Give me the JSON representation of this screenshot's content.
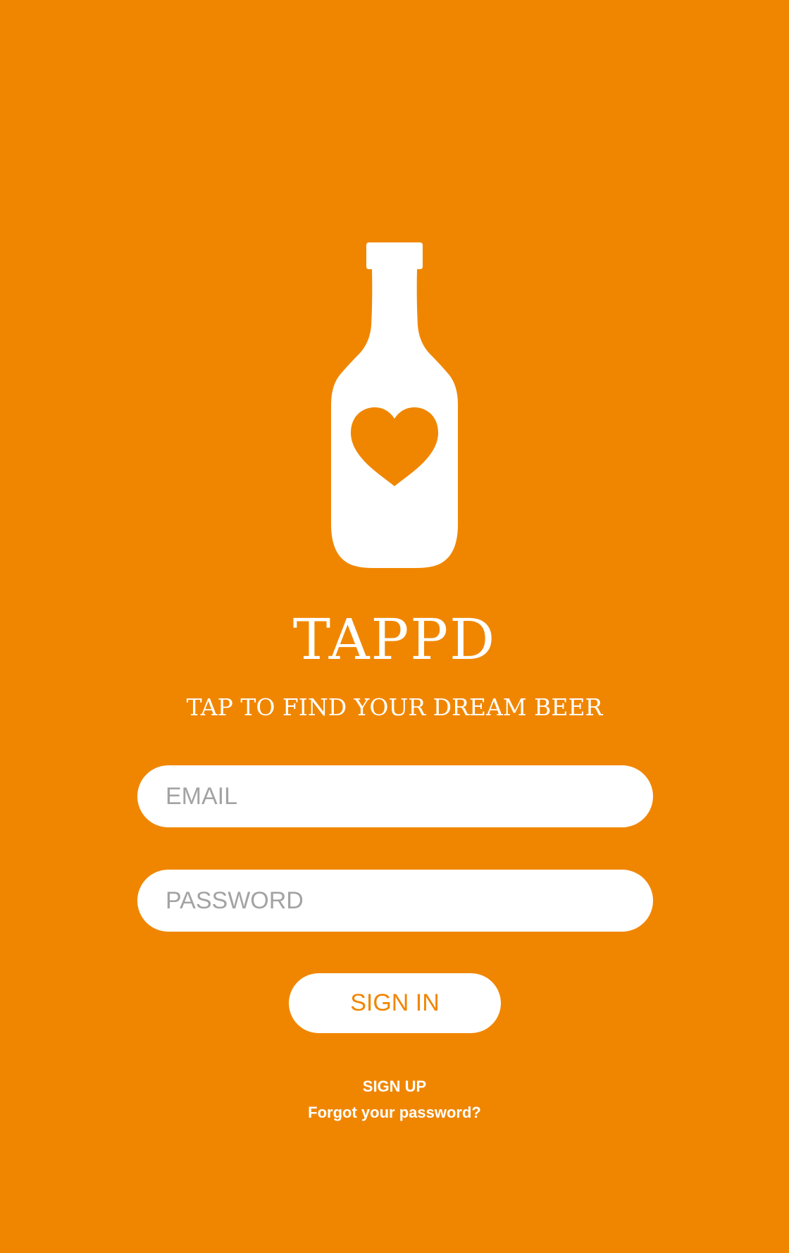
{
  "brand": {
    "title": "TAPPD",
    "tagline": "TAP TO FIND YOUR DREAM BEER",
    "logo_icon": "beer-bottle-heart-icon"
  },
  "form": {
    "email_placeholder": "EMAIL",
    "password_placeholder": "PASSWORD",
    "signin_label": "SIGN IN"
  },
  "links": {
    "signup": "SIGN UP",
    "forgot": "Forgot your password?"
  },
  "colors": {
    "background": "#f08600",
    "foreground": "#ffffff",
    "placeholder": "#a3a3a3",
    "accent": "#f08600"
  }
}
